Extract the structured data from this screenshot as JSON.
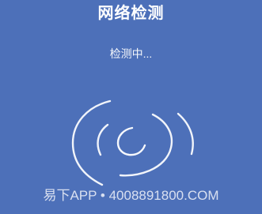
{
  "header": {
    "title": "网络检测"
  },
  "status": {
    "text": "检测中..."
  },
  "spinner": {
    "icon": "loading-arcs-icon",
    "color": "#ffffff"
  },
  "watermark": {
    "text": "易下APP • 4008891800.COM"
  },
  "colors": {
    "background": "#4d70b9",
    "text": "#ffffff"
  }
}
